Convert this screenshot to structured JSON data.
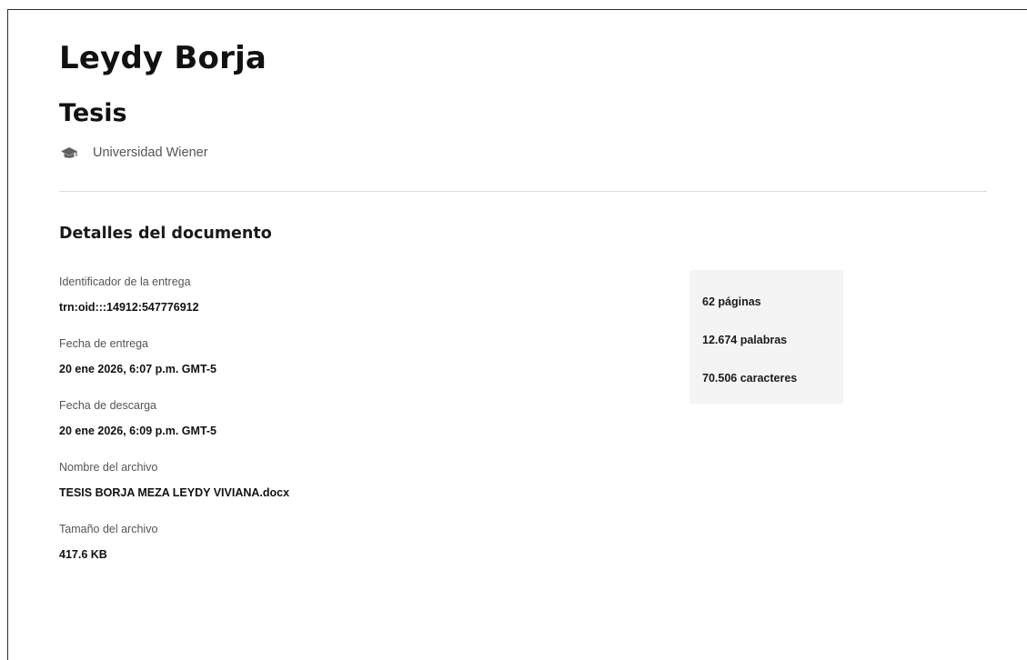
{
  "header": {
    "author": "Leydy Borja",
    "document_type": "Tesis",
    "institution_icon": "graduation-cap-icon",
    "institution": "Universidad Wiener"
  },
  "details": {
    "section_title": "Detalles del documento",
    "items": [
      {
        "label": "Identificador de la entrega",
        "value": "trn:oid:::14912:547776912"
      },
      {
        "label": "Fecha de entrega",
        "value": "20 ene 2026, 6:07 p.m. GMT-5"
      },
      {
        "label": "Fecha de descarga",
        "value": "20 ene 2026, 6:09 p.m. GMT-5"
      },
      {
        "label": "Nombre del archivo",
        "value": "TESIS BORJA MEZA LEYDY VIVIANA.docx"
      },
      {
        "label": "Tamaño del archivo",
        "value": "417.6 KB"
      }
    ]
  },
  "stats": {
    "pages": "62 páginas",
    "words": "12.674 palabras",
    "characters": "70.506 caracteres"
  }
}
